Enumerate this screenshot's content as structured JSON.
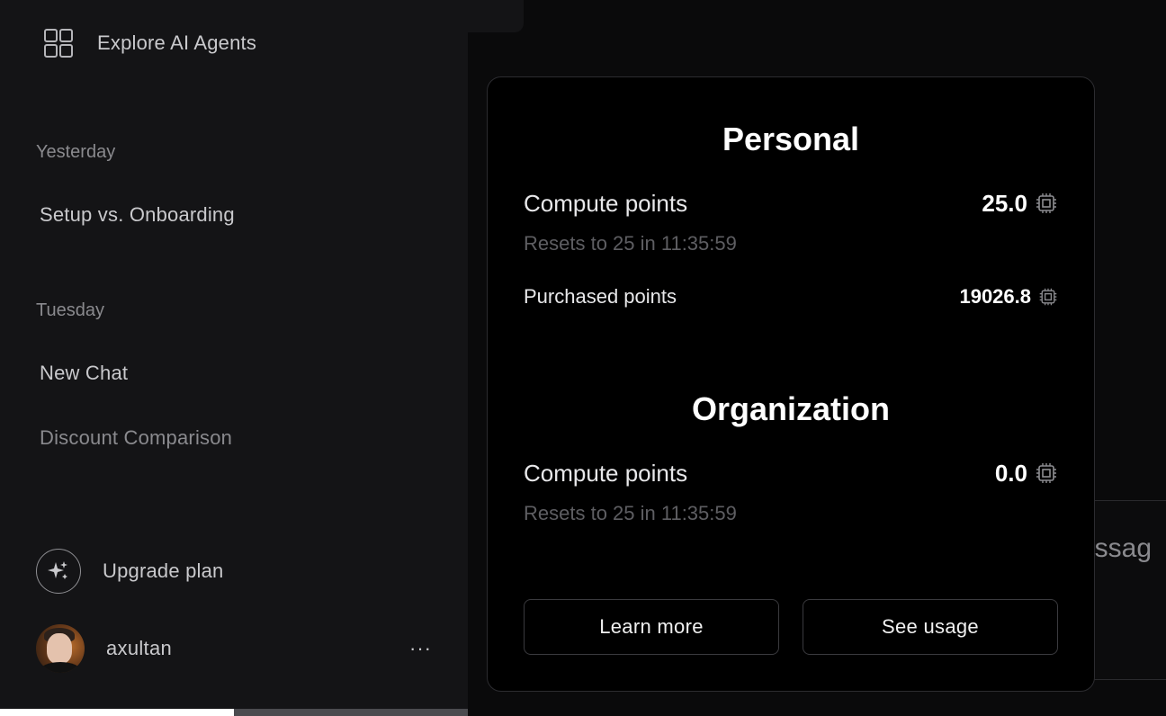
{
  "sidebar": {
    "explore_label": "Explore AI Agents",
    "sections": [
      {
        "heading": "Yesterday",
        "items": [
          "Setup vs. Onboarding"
        ]
      },
      {
        "heading": "Tuesday",
        "items": [
          "New Chat",
          "Discount Comparison"
        ]
      }
    ],
    "upgrade_label": "Upgrade plan",
    "username": "axultan",
    "more_label": "···"
  },
  "background": {
    "message_partial": "essag"
  },
  "popup": {
    "personal": {
      "title": "Personal",
      "compute_label": "Compute points",
      "compute_value": "25.0",
      "reset_text": "Resets to 25 in 11:35:59",
      "purchased_label": "Purchased points",
      "purchased_value": "19026.8"
    },
    "organization": {
      "title": "Organization",
      "compute_label": "Compute points",
      "compute_value": "0.0",
      "reset_text": "Resets to 25 in 11:35:59"
    },
    "buttons": {
      "learn_more": "Learn more",
      "see_usage": "See usage"
    },
    "icon": "chip-icon"
  }
}
